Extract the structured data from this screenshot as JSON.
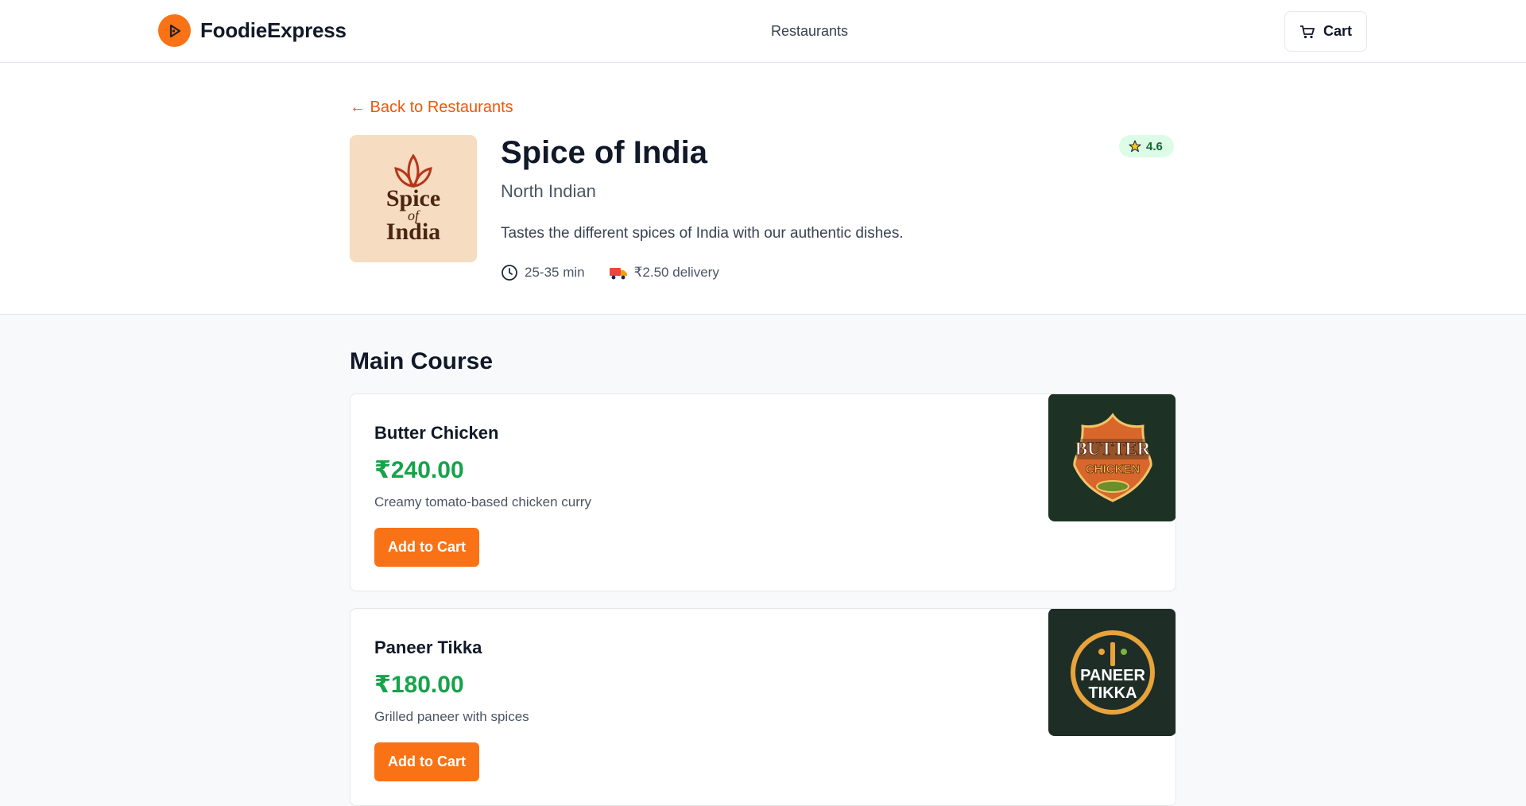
{
  "header": {
    "brand": "FoodieExpress",
    "nav_restaurants": "Restaurants",
    "cart_label": "Cart",
    "accent_color": "#f97316"
  },
  "restaurant": {
    "back_link": "← Back to Restaurants",
    "name": "Spice of India",
    "cuisine": "North Indian",
    "description": "Tastes the different spices of India with our authentic dishes.",
    "delivery_time": "25-35 min",
    "delivery_fee": "₹2.50 delivery",
    "rating": "4.6",
    "logo_text": [
      "Spice",
      "of",
      "India"
    ]
  },
  "menu": {
    "section_title": "Main Course",
    "items": [
      {
        "name": "Butter Chicken",
        "price": "₹240.00",
        "description": "Creamy tomato-based chicken curry",
        "button": "Add to Cart",
        "image_text": [
          "BUTTER",
          "CHICKEN"
        ]
      },
      {
        "name": "Paneer Tikka",
        "price": "₹180.00",
        "description": "Grilled paneer with spices",
        "button": "Add to Cart",
        "image_text": [
          "PANEER",
          "TIKKA"
        ]
      }
    ]
  }
}
